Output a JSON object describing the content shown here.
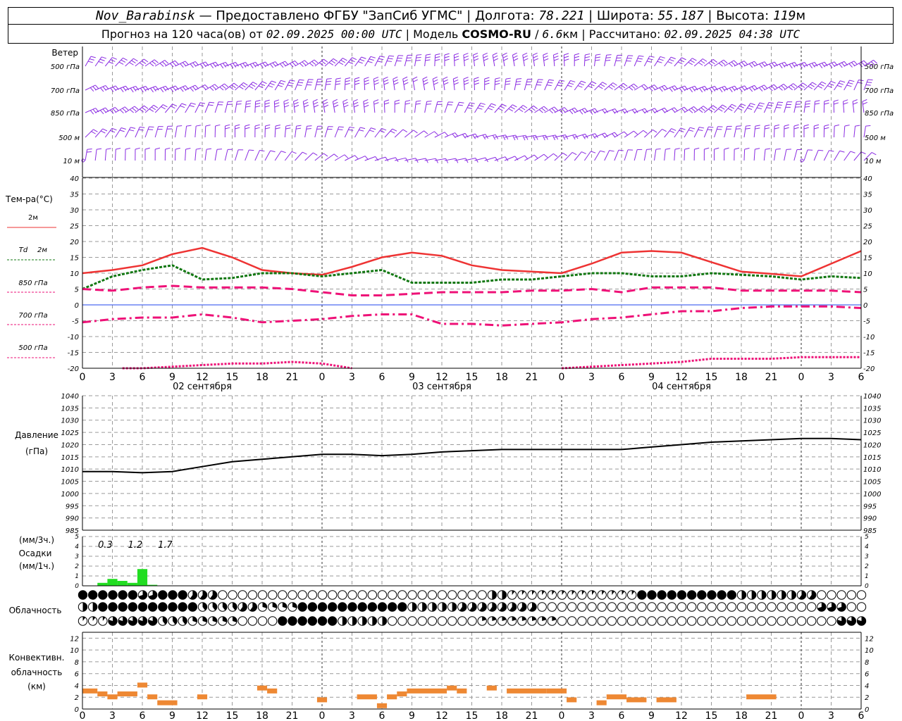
{
  "header": {
    "station": "Nov_Barabinsk",
    "dash": "—",
    "provided": "Предоставлено ФГБУ \"ЗапСиб УГМС\"",
    "lon_label": "Долгота:",
    "lon_value": "78.221",
    "lat_label": "Широта:",
    "lat_value": "55.187",
    "alt_label": "Высота:",
    "alt_value": "119",
    "alt_unit": "м",
    "forecast_label": "Прогноз на 120 часа(ов) от",
    "forecast_time": "02.09.2025 00:00 UTC",
    "model_label": "Модель",
    "model_name": "COSMO-RU",
    "model_res": "6.6",
    "model_res_unit": "км",
    "calc_label": "Рассчитано:",
    "calc_time": "02.09.2025 04:38 UTC"
  },
  "labels": {
    "wind": "Ветер",
    "levels": [
      "500 гПа",
      "700 гПа",
      "850 гПа",
      "500 м",
      "10  м"
    ],
    "temp_title": "Тем-ра(°С)",
    "t2m": "2м",
    "td2m_a": "Td",
    "td2m_b": "2м",
    "t850": "850 гПа",
    "t700": "700 гПа",
    "t500": "500 гПа",
    "pressure_a": "Давление",
    "pressure_b": "(гПа)",
    "precip_a": "(мм/3ч.)",
    "precip_b": "Осадки",
    "precip_c": "(мм/1ч.)",
    "cloud": "Облачность",
    "conv_a": "Конвективн.",
    "conv_b": "облачность",
    "conv_c": "(км)",
    "dates": [
      "02 сентября",
      "03 сентября",
      "04 сентября"
    ],
    "precip_values": [
      "0.3",
      "1.2",
      "1.7"
    ]
  },
  "colors": {
    "wind": "#8a2be2",
    "t2m": "#ee3333",
    "td2m": "#117711",
    "t850": "#ee1177",
    "t700": "#ee1177",
    "t500": "#ee1177",
    "zero": "#2244ee",
    "pressure": "#000000",
    "precip": "#22dd22",
    "conv": "#ee8833",
    "grid": "#9a9a9a"
  },
  "chart_data": [
    {
      "type": "line",
      "name": "temperature",
      "x_hours_from": "02.09.2025 00:00 UTC",
      "x_ticks": [
        "0",
        "3",
        "6",
        "9",
        "12",
        "15",
        "18",
        "21",
        "0",
        "3",
        "6",
        "9",
        "12",
        "15",
        "18",
        "21",
        "0",
        "3",
        "6",
        "9",
        "12",
        "15",
        "18",
        "21",
        "0",
        "3",
        "6"
      ],
      "ylim": [
        -20,
        40
      ],
      "yticks": [
        -20,
        -15,
        -10,
        -5,
        0,
        5,
        10,
        15,
        20,
        25,
        30,
        35,
        40
      ],
      "series": [
        {
          "name": "2м",
          "key": "t2m",
          "x": [
            0,
            3,
            6,
            9,
            12,
            15,
            18,
            21,
            24,
            27,
            30,
            33,
            36,
            39,
            42,
            45,
            48,
            51,
            54,
            57,
            60,
            63,
            66,
            69,
            72,
            75,
            78
          ],
          "values": [
            10,
            11,
            12.5,
            16,
            18,
            15,
            11,
            10,
            9.5,
            12,
            15,
            16.5,
            15.5,
            12.5,
            11,
            10.5,
            10,
            13,
            16.5,
            17,
            16.5,
            13.5,
            10.5,
            9.8,
            9,
            13,
            17
          ]
        },
        {
          "name": "Td 2м",
          "key": "td2m",
          "x": [
            0,
            3,
            6,
            9,
            12,
            15,
            18,
            21,
            24,
            27,
            30,
            33,
            36,
            39,
            42,
            45,
            48,
            51,
            54,
            57,
            60,
            63,
            66,
            69,
            72,
            75,
            78
          ],
          "values": [
            5,
            9,
            11,
            12.5,
            8,
            8.5,
            10,
            10,
            9,
            10,
            11,
            7,
            7,
            7,
            8,
            8,
            9,
            10,
            10,
            9,
            9,
            10,
            9.5,
            9,
            8,
            9,
            8.5
          ]
        },
        {
          "name": "850 гПа",
          "key": "t850",
          "x": [
            0,
            3,
            6,
            9,
            12,
            15,
            18,
            21,
            24,
            27,
            30,
            33,
            36,
            39,
            42,
            45,
            48,
            51,
            54,
            57,
            60,
            63,
            66,
            69,
            72,
            75,
            78
          ],
          "values": [
            5,
            4.5,
            5.5,
            6,
            5.5,
            5.5,
            5.5,
            5,
            4,
            3,
            3,
            3.5,
            4,
            4,
            4,
            4.5,
            4.5,
            5,
            4,
            5.5,
            5.5,
            5.5,
            4.5,
            4.5,
            4.5,
            4.5,
            4
          ]
        },
        {
          "name": "700 гПа",
          "key": "t700",
          "x": [
            0,
            3,
            6,
            9,
            12,
            15,
            18,
            21,
            24,
            27,
            30,
            33,
            36,
            39,
            42,
            45,
            48,
            51,
            54,
            57,
            60,
            63,
            66,
            69,
            72,
            75,
            78
          ],
          "values": [
            -5.5,
            -4.5,
            -4,
            -4,
            -3,
            -4,
            -5.5,
            -5,
            -4.5,
            -3.5,
            -3,
            -3,
            -6,
            -6,
            -6.5,
            -6,
            -5.5,
            -4.5,
            -4,
            -3,
            -2,
            -2,
            -1,
            -0.5,
            -0.5,
            -0.5,
            -1
          ]
        },
        {
          "name": "500 гПа",
          "key": "t500",
          "x": [
            4,
            6,
            9,
            12,
            15,
            18,
            21,
            24,
            27,
            48,
            51,
            54,
            57,
            60,
            63,
            66,
            69,
            72,
            75,
            78
          ],
          "values": [
            -20,
            -20,
            -19.5,
            -19,
            -18.5,
            -18.5,
            -18,
            -18.5,
            -20,
            -20,
            -19.5,
            -19,
            -18.5,
            -18,
            -17,
            -17,
            -17,
            -16.5,
            -16.5,
            -16.5
          ]
        }
      ]
    },
    {
      "type": "line",
      "name": "pressure",
      "ylim": [
        985,
        1040
      ],
      "yticks": [
        985,
        990,
        995,
        1000,
        1005,
        1010,
        1015,
        1020,
        1025,
        1030,
        1035,
        1040
      ],
      "x": [
        0,
        3,
        6,
        9,
        12,
        15,
        18,
        21,
        24,
        27,
        30,
        33,
        36,
        39,
        42,
        45,
        48,
        51,
        54,
        57,
        60,
        63,
        66,
        69,
        72,
        75,
        78
      ],
      "values": [
        1009,
        1009,
        1008.5,
        1009,
        1011,
        1013,
        1014,
        1015,
        1016,
        1016,
        1015.5,
        1016,
        1017,
        1017.5,
        1018,
        1018,
        1018,
        1018,
        1018,
        1019,
        1020,
        1021,
        1021.5,
        1022,
        1022.5,
        1022.5,
        1022
      ]
    },
    {
      "type": "bar",
      "name": "precipitation",
      "ylim": [
        0,
        5
      ],
      "yticks": [
        0,
        1,
        2,
        3,
        4,
        5
      ],
      "x": [
        2,
        3,
        4,
        5,
        6,
        7
      ],
      "values": [
        0.3,
        0.7,
        0.5,
        0.3,
        1.7,
        0.1
      ]
    },
    {
      "type": "bar",
      "name": "convective cloud",
      "ylim": [
        0,
        13
      ],
      "yticks": [
        0,
        2,
        4,
        6,
        8,
        10,
        12
      ],
      "segments": [
        [
          0,
          1.5,
          3
        ],
        [
          1.5,
          2.5,
          2.5
        ],
        [
          2.5,
          3.5,
          2
        ],
        [
          3.5,
          5.5,
          2.5
        ],
        [
          5.5,
          6.5,
          4
        ],
        [
          6.5,
          7.5,
          2
        ],
        [
          7.5,
          9.5,
          1
        ],
        [
          11.5,
          12.5,
          2
        ],
        [
          17.5,
          18.5,
          3.5
        ],
        [
          18.5,
          19.5,
          3
        ],
        [
          23.5,
          24.5,
          1.5
        ],
        [
          27.5,
          29.5,
          2
        ],
        [
          29.5,
          30.5,
          0.5
        ],
        [
          30.5,
          31.5,
          2
        ],
        [
          31.5,
          32.5,
          2.5
        ],
        [
          32.5,
          36.5,
          3
        ],
        [
          36.5,
          37.5,
          3.5
        ],
        [
          37.5,
          38.5,
          3
        ],
        [
          40.5,
          41.5,
          3.5
        ],
        [
          42.5,
          46.5,
          3
        ],
        [
          46.5,
          48.5,
          3
        ],
        [
          48.5,
          49.5,
          1.5
        ],
        [
          51.5,
          52.5,
          1
        ],
        [
          52.5,
          54.5,
          2
        ],
        [
          54.5,
          56.5,
          1.5
        ],
        [
          57.5,
          59.5,
          1.5
        ],
        [
          66.5,
          69.5,
          2
        ]
      ]
    }
  ]
}
